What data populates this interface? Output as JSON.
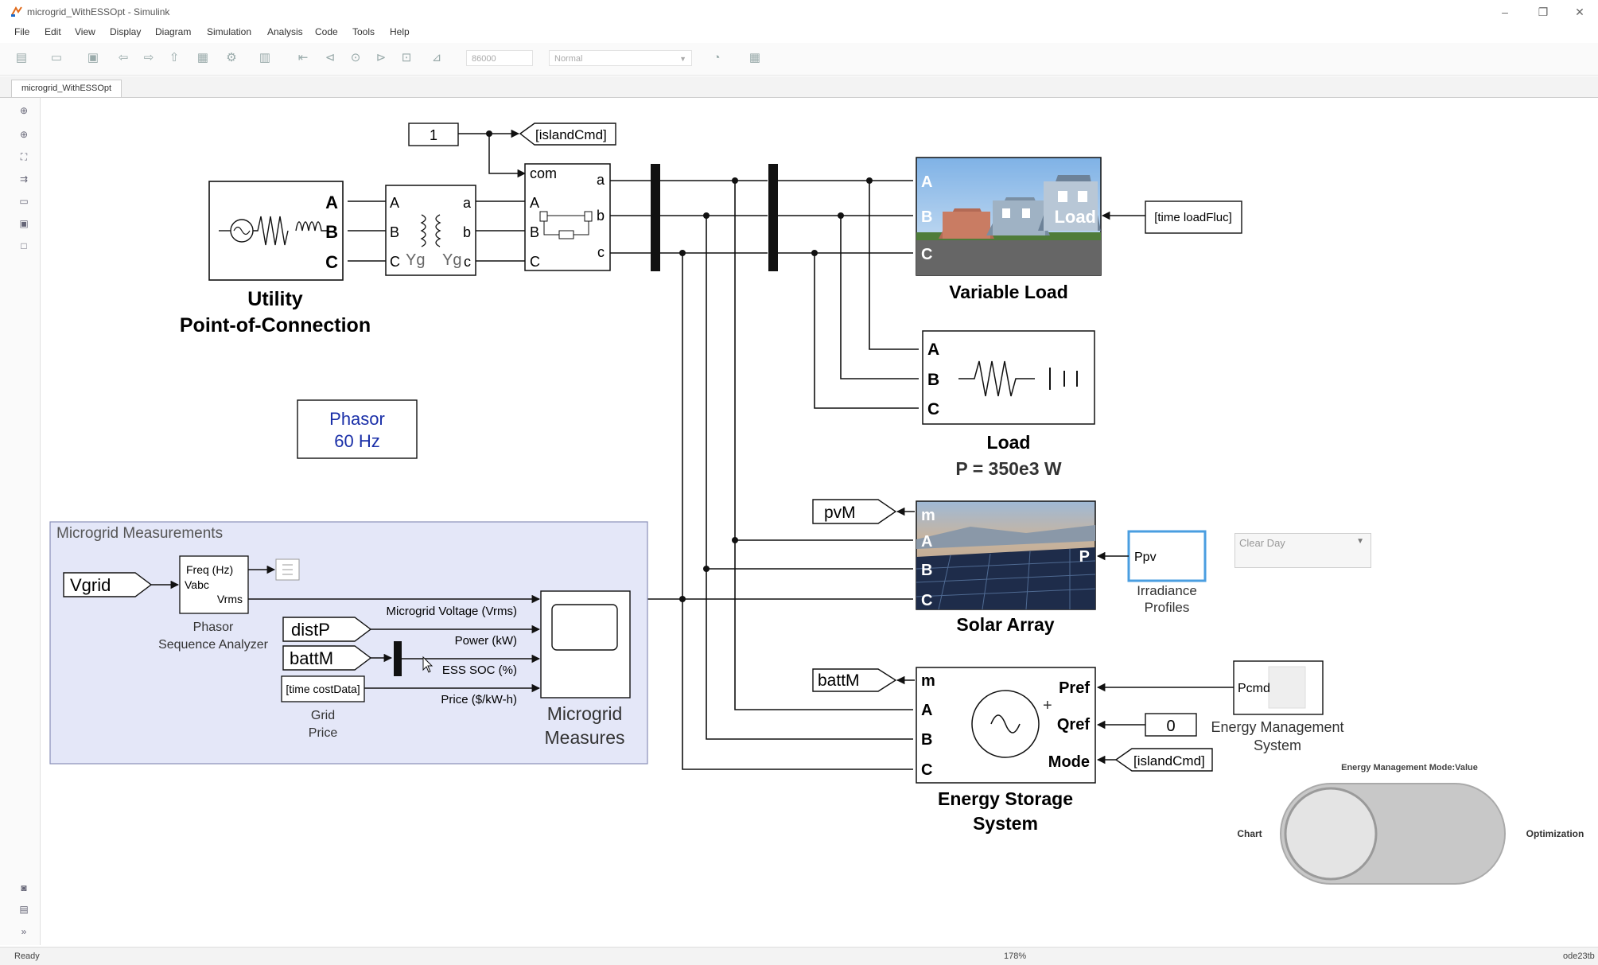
{
  "window": {
    "title": "microgrid_WithESSOpt - Simulink",
    "min_glyph": "–",
    "restore_glyph": "❐",
    "close_glyph": "✕"
  },
  "menu": [
    "File",
    "Edit",
    "View",
    "Display",
    "Diagram",
    "Simulation",
    "Analysis",
    "Code",
    "Tools",
    "Help"
  ],
  "toolbar": {
    "stop_time": "86000",
    "sim_mode": "Normal"
  },
  "tab": {
    "label": "microgrid_WithESSOpt"
  },
  "status": {
    "left": "Ready",
    "zoom": "178%",
    "solver": "ode23tb"
  },
  "diagram": {
    "const_one": "1",
    "goto_island": "[islandCmd]",
    "utility": {
      "title1": "Utility",
      "title2": "Point-of-Connection",
      "ports": [
        "A",
        "B",
        "C"
      ]
    },
    "transformer": {
      "in": [
        "A",
        "B",
        "C"
      ],
      "out": [
        "a",
        "b",
        "c"
      ],
      "yg1": "Yg",
      "yg2": "Yg"
    },
    "breaker": {
      "com": "com",
      "in": [
        "A",
        "B",
        "C"
      ],
      "out": [
        "a",
        "b",
        "c"
      ]
    },
    "powergui": {
      "line1": "Phasor",
      "line2": "60 Hz"
    },
    "variable_load": {
      "title": "Variable Load",
      "ports": [
        "A",
        "B",
        "C"
      ],
      "label": "Load",
      "from_tag": "[time loadFluc]"
    },
    "rl_load": {
      "title": "Load",
      "subtitle": "P = 350e3 W",
      "ports": [
        "A",
        "B",
        "C"
      ]
    },
    "solar": {
      "title": "Solar Array",
      "ports": [
        "m",
        "A",
        "B",
        "C"
      ],
      "out": "P",
      "meas_tag": "pvM"
    },
    "irradiance": {
      "port": "Ppv",
      "label1": "Irradiance",
      "label2": "Profiles",
      "dropdown": "Clear Day"
    },
    "ess": {
      "title1": "Energy Storage",
      "title2": "System",
      "in_ports": [
        "m",
        "A",
        "B",
        "C"
      ],
      "right_ports": [
        "Pref",
        "Qref",
        "Mode"
      ],
      "meas_tag": "battM",
      "qref_const": "0",
      "island_tag": "[islandCmd]"
    },
    "ems": {
      "port": "Pcmd",
      "label1": "Energy Management",
      "label2": "System"
    },
    "toggle": {
      "title": "Energy Management Mode:Value",
      "left": "Chart",
      "right": "Optimization",
      "state": "Chart"
    },
    "measurements": {
      "title": "Microgrid Measurements",
      "vgrid": "Vgrid",
      "analyzer": {
        "freq": "Freq (Hz)",
        "vabc": "Vabc",
        "vrms": "Vrms",
        "label1": "Phasor",
        "label2": "Sequence Analyzer"
      },
      "distp": "distP",
      "battm": "battM",
      "cost_tag": "[time costData]",
      "grid_price1": "Grid",
      "grid_price2": "Price",
      "signals": [
        "Microgrid Voltage (Vrms)",
        "Power  (kW)",
        "ESS SOC (%)",
        "Price ($/kW-h)"
      ],
      "scope1": "Microgrid",
      "scope2": "Measures"
    }
  }
}
